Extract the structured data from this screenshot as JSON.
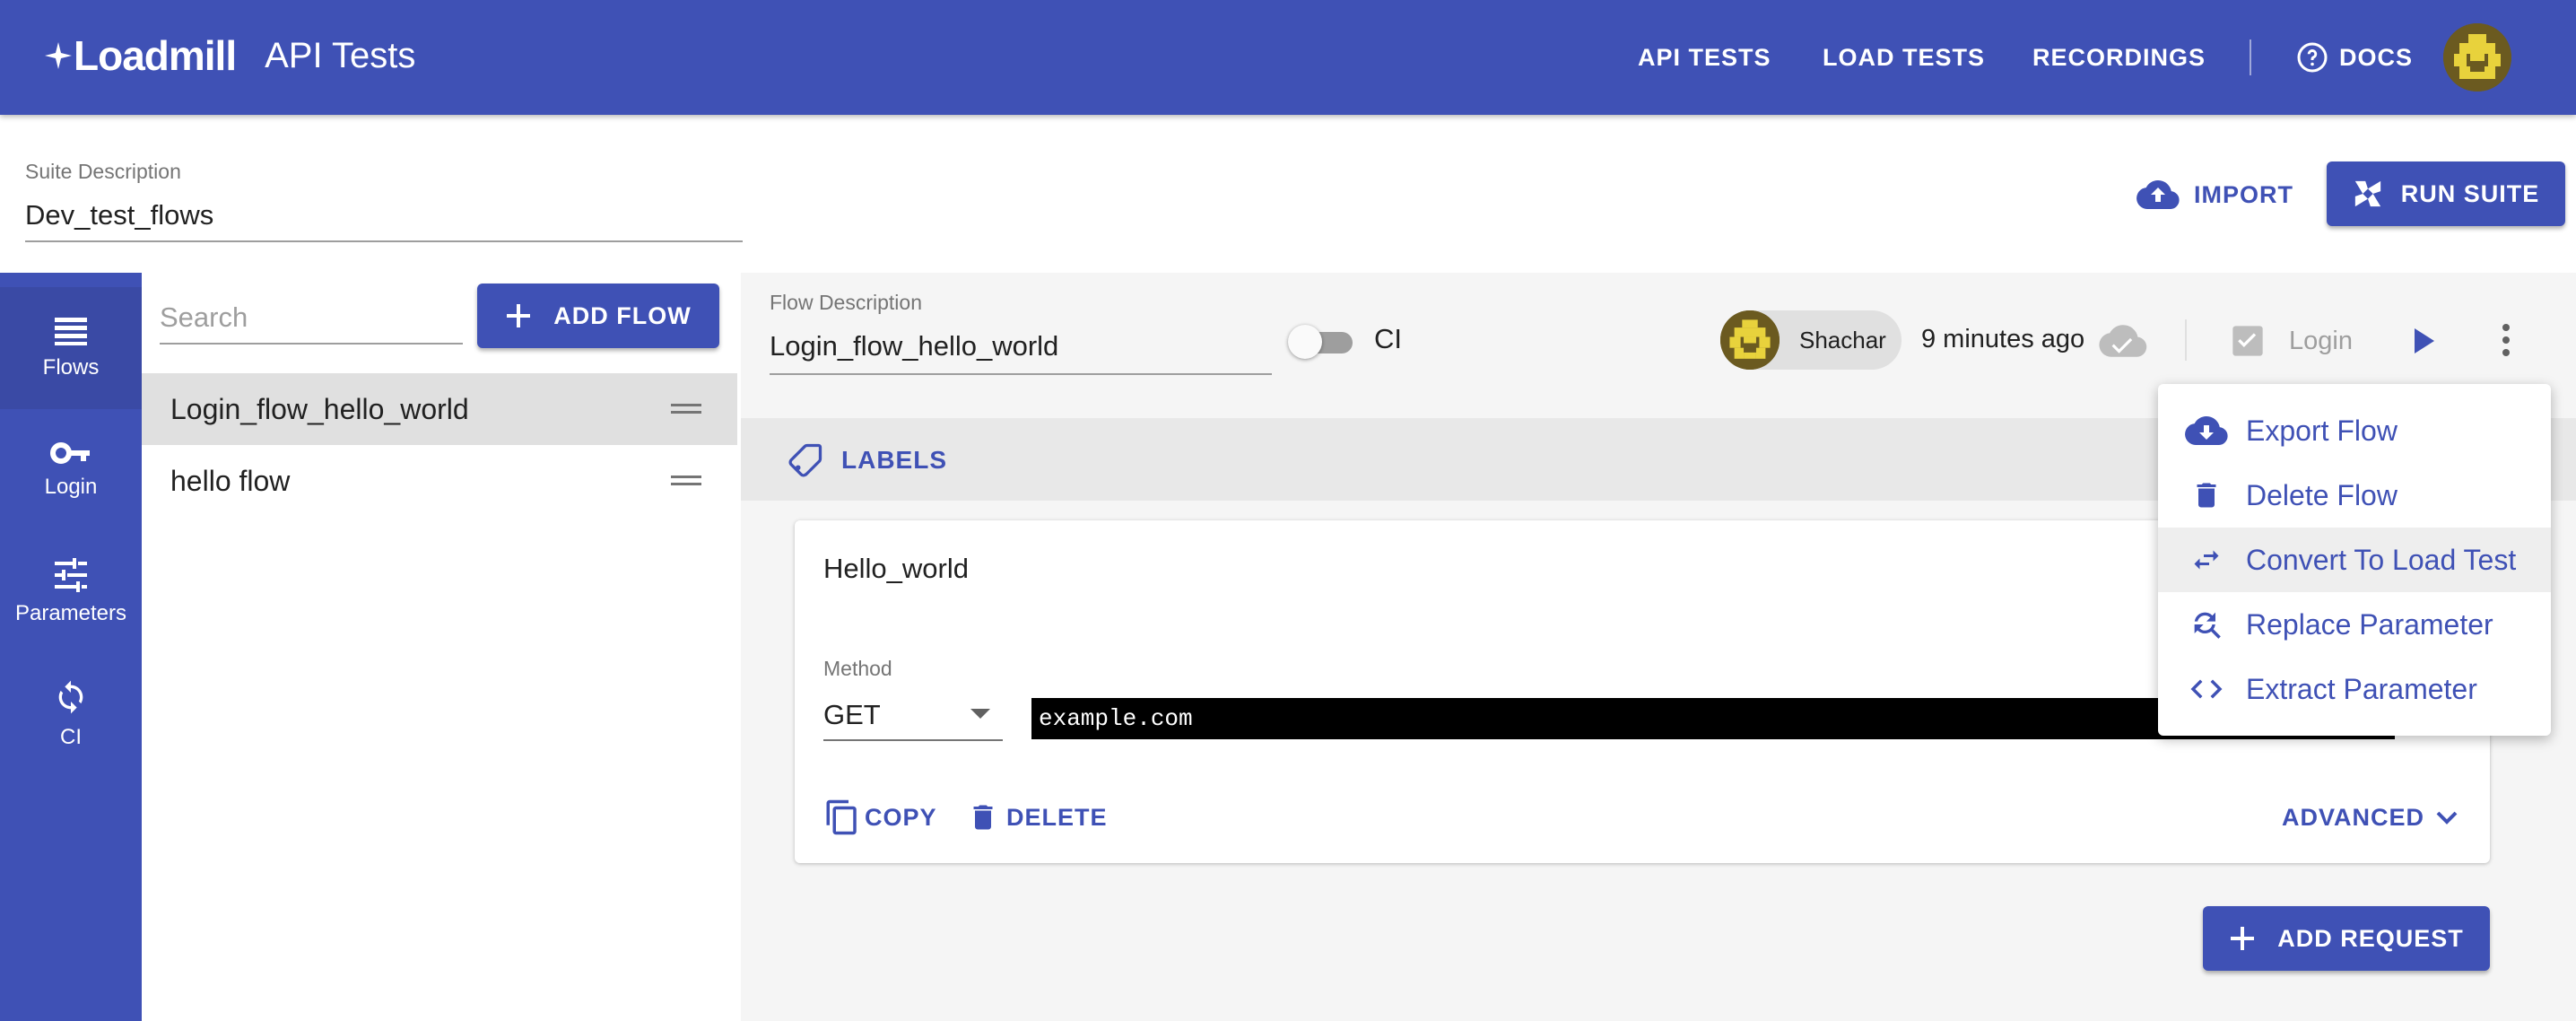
{
  "header": {
    "logo_text": "Loadmill",
    "title": "API Tests",
    "nav": [
      {
        "label": "API TESTS"
      },
      {
        "label": "LOAD TESTS"
      },
      {
        "label": "RECORDINGS"
      },
      {
        "label": "DOCS"
      }
    ]
  },
  "suite": {
    "description_label": "Suite Description",
    "description_value": "Dev_test_flows",
    "import_label": "IMPORT",
    "run_label": "RUN SUITE"
  },
  "rail": {
    "items": [
      {
        "label": "Flows",
        "icon": "list-icon",
        "active": true
      },
      {
        "label": "Login",
        "icon": "key-icon"
      },
      {
        "label": "Parameters",
        "icon": "tune-icon"
      },
      {
        "label": "CI",
        "icon": "sync-icon"
      }
    ]
  },
  "flows": {
    "search_placeholder": "Search",
    "add_label": "ADD FLOW",
    "items": [
      {
        "name": "Login_flow_hello_world",
        "selected": true
      },
      {
        "name": "hello flow"
      }
    ]
  },
  "flow": {
    "description_label": "Flow Description",
    "description_value": "Login_flow_hello_world",
    "ci_label": "CI",
    "owner": "Shachar",
    "updated": "9 minutes ago",
    "login_label": "Login",
    "labels_label": "LABELS"
  },
  "request": {
    "title": "Hello_world",
    "method_label": "Method",
    "method_value": "GET",
    "url": "example.com",
    "copy_label": "COPY",
    "delete_label": "DELETE",
    "advanced_label": "ADVANCED",
    "add_request_label": "ADD REQUEST"
  },
  "menu": {
    "items": [
      {
        "label": "Export Flow",
        "icon": "cloud-download-icon"
      },
      {
        "label": "Delete Flow",
        "icon": "trash-icon"
      },
      {
        "label": "Convert To Load Test",
        "icon": "swap-icon",
        "hover": true
      },
      {
        "label": "Replace Parameter",
        "icon": "find-replace-icon"
      },
      {
        "label": "Extract Parameter",
        "icon": "code-icon"
      }
    ]
  },
  "colors": {
    "primary": "#3f51b5",
    "appbar": "#3f51b5",
    "selected_row": "#e0e0e0"
  }
}
